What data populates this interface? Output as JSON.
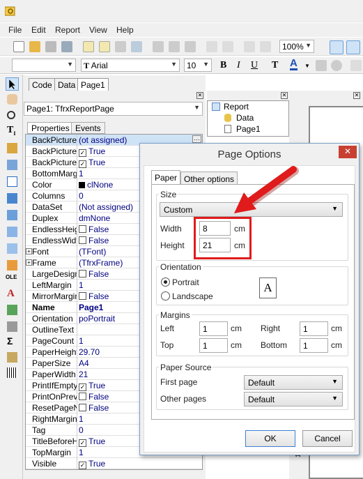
{
  "menu": {
    "items": [
      "File",
      "Edit",
      "Report",
      "View",
      "Help"
    ]
  },
  "toolbar": {
    "zoom": "100%",
    "font_name": "Arial",
    "font_size": "10",
    "style_value": ""
  },
  "left_tabs": [
    "Code",
    "Data",
    "Page1"
  ],
  "object_inspector": {
    "selected_object": "Page1: TfrxReportPage",
    "tabs": [
      "Properties",
      "Events"
    ],
    "properties": [
      {
        "name": "BackPicture",
        "value": "(ot assigned)",
        "check": false,
        "expand": false,
        "bold": false
      },
      {
        "name": "BackPicturePrintable",
        "value": "True",
        "check": true,
        "expand": false,
        "bold": false
      },
      {
        "name": "BackPictureVisible",
        "value": "True",
        "check": true,
        "expand": false,
        "bold": false
      },
      {
        "name": "BottomMargin",
        "value": "1",
        "check": false,
        "expand": false,
        "bold": false
      },
      {
        "name": "Color",
        "value": "clNone",
        "check": false,
        "expand": false,
        "bold": false,
        "swatch": "#000000"
      },
      {
        "name": "Columns",
        "value": "0",
        "check": false,
        "expand": false,
        "bold": false
      },
      {
        "name": "DataSet",
        "value": "(Not assigned)",
        "check": false,
        "expand": false,
        "bold": false
      },
      {
        "name": "Duplex",
        "value": "dmNone",
        "check": false,
        "expand": false,
        "bold": false
      },
      {
        "name": "EndlessHeight",
        "value": "False",
        "check": true,
        "checked": false,
        "expand": false,
        "bold": false
      },
      {
        "name": "EndlessWidth",
        "value": "False",
        "check": true,
        "checked": false,
        "expand": false,
        "bold": false
      },
      {
        "name": "Font",
        "value": "(TFont)",
        "check": false,
        "expand": true,
        "bold": false
      },
      {
        "name": "Frame",
        "value": "(TfrxFrame)",
        "check": false,
        "expand": true,
        "bold": false
      },
      {
        "name": "LargeDesignHeight",
        "value": "False",
        "check": true,
        "checked": false,
        "expand": false,
        "bold": false
      },
      {
        "name": "LeftMargin",
        "value": "1",
        "check": false,
        "expand": false,
        "bold": false
      },
      {
        "name": "MirrorMargins",
        "value": "False",
        "check": true,
        "checked": false,
        "expand": false,
        "bold": false
      },
      {
        "name": "Name",
        "value": "Page1",
        "check": false,
        "expand": false,
        "bold": true
      },
      {
        "name": "Orientation",
        "value": "poPortrait",
        "check": false,
        "expand": false,
        "bold": false
      },
      {
        "name": "OutlineText",
        "value": "",
        "check": false,
        "expand": false,
        "bold": false
      },
      {
        "name": "PageCount",
        "value": "1",
        "check": false,
        "expand": false,
        "bold": false
      },
      {
        "name": "PaperHeight",
        "value": "29.70",
        "check": false,
        "expand": false,
        "bold": false
      },
      {
        "name": "PaperSize",
        "value": "A4",
        "check": false,
        "expand": false,
        "bold": false
      },
      {
        "name": "PaperWidth",
        "value": "21",
        "check": false,
        "expand": false,
        "bold": false
      },
      {
        "name": "PrintIfEmpty",
        "value": "True",
        "check": true,
        "checked": true,
        "expand": false,
        "bold": false
      },
      {
        "name": "PrintOnPreviousPage",
        "value": "False",
        "check": true,
        "checked": false,
        "expand": false,
        "bold": false
      },
      {
        "name": "ResetPageNumbers",
        "value": "False",
        "check": true,
        "checked": false,
        "expand": false,
        "bold": false
      },
      {
        "name": "RightMargin",
        "value": "1",
        "check": false,
        "expand": false,
        "bold": false
      },
      {
        "name": "Tag",
        "value": "0",
        "check": false,
        "expand": false,
        "bold": false
      },
      {
        "name": "TitleBeforeHeader",
        "value": "True",
        "check": true,
        "checked": true,
        "expand": false,
        "bold": false
      },
      {
        "name": "TopMargin",
        "value": "1",
        "check": false,
        "expand": false,
        "bold": false
      },
      {
        "name": "Visible",
        "value": "True",
        "check": true,
        "checked": true,
        "expand": false,
        "bold": false
      }
    ]
  },
  "report_tree": {
    "root": "Report",
    "children": [
      "Data",
      "Page1"
    ]
  },
  "dialog": {
    "title": "Page Options",
    "close": "✕",
    "tabs": [
      "Paper",
      "Other options"
    ],
    "size": {
      "label": "Size",
      "preset": "Custom",
      "width_label": "Width",
      "width": "8",
      "height_label": "Height",
      "height": "21",
      "unit": "cm"
    },
    "orientation": {
      "label": "Orientation",
      "portrait": "Portrait",
      "landscape": "Landscape",
      "selected": "portrait",
      "preview_letter": "A"
    },
    "margins": {
      "label": "Margins",
      "left_label": "Left",
      "left": "1",
      "right_label": "Right",
      "right": "1",
      "top_label": "Top",
      "top": "1",
      "bottom_label": "Bottom",
      "bottom": "1",
      "unit": "cm"
    },
    "paper_source": {
      "label": "Paper Source",
      "first_label": "First page",
      "first": "Default",
      "other_label": "Other pages",
      "other": "Default"
    },
    "ok": "OK",
    "cancel": "Cancel"
  },
  "ruler_mark": "12",
  "colors": {
    "highlight": "#e01b1b",
    "arrow": "#e01b1b",
    "close_bg": "#c84031"
  }
}
